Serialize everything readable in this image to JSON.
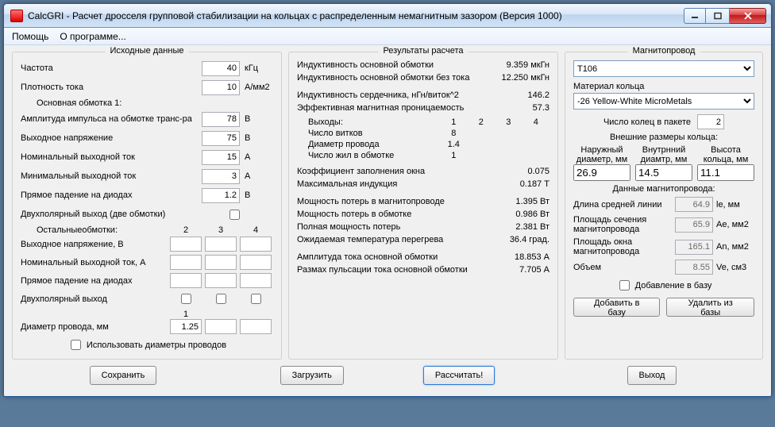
{
  "window": {
    "title": "CalcGRI - Расчет дросселя групповой стабилизации на кольцах с распределенным немагнитным зазором (Версия 1000)"
  },
  "menu": {
    "help": "Помощь",
    "about": "О программе..."
  },
  "groups": {
    "input": "Исходные данные",
    "result": "Результаты расчета",
    "core": "Магнитопровод"
  },
  "in": {
    "freq_l": "Частота",
    "freq_v": "40",
    "freq_u": "кГц",
    "dens_l": "Плотность тока",
    "dens_v": "10",
    "dens_u": "А/мм2",
    "w1_head": "Основная обмотка 1:",
    "amp_l": "Амплитуда импульса на обмотке транс-ра",
    "amp_v": "78",
    "amp_u": "В",
    "vo_l": "Выходное напряжение",
    "vo_v": "75",
    "vo_u": "В",
    "in_l": "Номинальный выходной ток",
    "in_v": "15",
    "in_u": "А",
    "imin_l": "Минимальный выходной ток",
    "imin_v": "3",
    "imin_u": "А",
    "vd_l": "Прямое падение на диодах",
    "vd_v": "1.2",
    "vd_u": "В",
    "bip_l": "Двухполярный выход (две обмотки)",
    "others_head": "Остальныеобмотки:",
    "cols": [
      "2",
      "3",
      "4"
    ],
    "ovo_l": "Выходное напряжение, В",
    "oin_l": "Номинальный выходной ток, А",
    "ovd_l": "Прямое падение на диодах",
    "obip_l": "Двухполярный выход",
    "dw_num": "1",
    "dw_l": "Диаметр провода, мм",
    "dw_v": "1.25",
    "use_dw": "Использовать диаметры проводов"
  },
  "res": {
    "L_l": "Индуктивность основной обмотки",
    "L_v": "9.359 мкГн",
    "L0_l": "Индуктивность основной обмотки без тока",
    "L0_v": "12.250 мкГн",
    "Al_l": "Индуктивность сердечника, нГн/виток^2",
    "Al_v": "146.2",
    "mu_l": "Эффективная магнитная проницаемость",
    "mu_v": "57.3",
    "outs_l": "Выходы:",
    "outs": [
      "1",
      "2",
      "3",
      "4"
    ],
    "turns_l": "Число витков",
    "turns": [
      "8",
      "",
      "",
      ""
    ],
    "dwire_l": "Диаметр провода",
    "dwire": [
      "1.4",
      "",
      "",
      ""
    ],
    "nstr_l": "Число жил в обмотке",
    "nstr": [
      "1",
      "",
      "",
      ""
    ],
    "fill_l": "Коэффициент заполнения окна",
    "fill_v": "0.075",
    "bmax_l": "Максимальная индукция",
    "bmax_v": "0.187 Т",
    "pcore_l": "Мощность потерь в магнитопроводе",
    "pcore_v": "1.395 Вт",
    "pwnd_l": "Мощность потерь в обмотке",
    "pwnd_v": "0.986 Вт",
    "ptot_l": "Полная мощность потерь",
    "ptot_v": "2.381 Вт",
    "dt_l": "Ожидаемая температура перегрева",
    "dt_v": "36.4 град.",
    "ipk_l": "Амплитуда тока основной обмотки",
    "ipk_v": "18.853 А",
    "irip_l": "Размах пульсации тока основной обмотки",
    "irip_v": "7.705 А"
  },
  "core": {
    "sel": "T106",
    "mat_l": "Материал кольца",
    "mat_sel": "-26 Yellow-White MicroMetals",
    "stack_l": "Число колец в пакете",
    "stack_v": "2",
    "ext_head": "Внешние размеры кольца:",
    "od_l": "Наружный диаметр, мм",
    "od_v": "26.9",
    "id_l": "Внутрнний диамтр, мм",
    "id_v": "14.5",
    "h_l": "Высота кольца, мм",
    "h_v": "11.1",
    "data_head": "Данные магнитопровода:",
    "le_l": "Длина средней линии",
    "le_v": "64.9",
    "le_u": "le, мм",
    "ae_l": "Площадь сечения магнитопровода",
    "ae_v": "65.9",
    "ae_u": "Ae, мм2",
    "an_l": "Площадь окна магнитопровода",
    "an_v": "165.1",
    "an_u": "An, мм2",
    "ve_l": "Объем",
    "ve_v": "8.55",
    "ve_u": "Ve, см3",
    "add_l": "Добавление в базу",
    "btn_add": "Добавить в базу",
    "btn_del": "Удалить из базы"
  },
  "btns": {
    "save": "Сохранить",
    "load": "Загрузить",
    "calc": "Рассчитать!",
    "exit": "Выход"
  }
}
